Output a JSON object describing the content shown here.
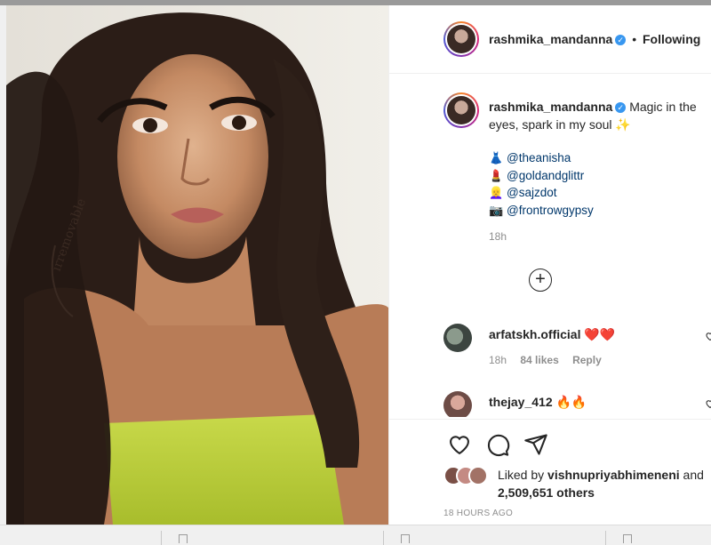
{
  "post": {
    "author": "rashmika_mandanna",
    "follow_status": "Following",
    "header_separator": "•",
    "caption": "Magic in the eyes, spark in my soul ✨",
    "mentions": [
      {
        "emoji": "👗",
        "handle": "@theanisha"
      },
      {
        "emoji": "💄",
        "handle": "@goldandglittr"
      },
      {
        "emoji": "👱‍♀️",
        "handle": "@sajzdot"
      },
      {
        "emoji": "📷",
        "handle": "@frontrowgypsy"
      }
    ],
    "caption_time": "18h",
    "load_more_icon": "plus-circle-icon",
    "comments": [
      {
        "user": "arfatskh.official",
        "text": "❤️❤️",
        "time": "18h",
        "likes": "84 likes",
        "reply": "Reply"
      },
      {
        "user": "thejay_412",
        "text": "🔥🔥",
        "time": "",
        "likes": "",
        "reply": ""
      }
    ],
    "liked_by_prefix": "Liked by",
    "liked_by_user": "vishnupriyabhimeneni",
    "liked_by_and": "and",
    "others": "2,509,651 others",
    "time_ago": "18 HOURS AGO"
  },
  "colors": {
    "verified": "#3897f0",
    "link": "#00376b",
    "secondary_text": "#8e8e8e",
    "heart": "#ed4956"
  }
}
